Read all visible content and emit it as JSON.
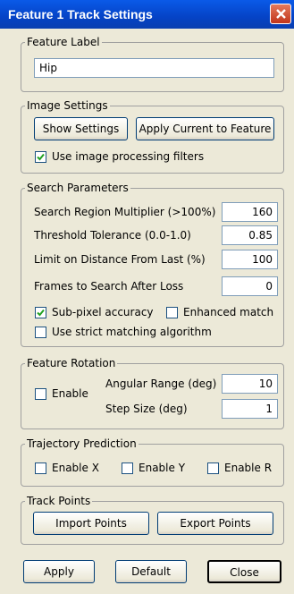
{
  "window": {
    "title": "Feature 1 Track Settings"
  },
  "feature_label": {
    "legend": "Feature Label",
    "value": "Hip"
  },
  "image_settings": {
    "legend": "Image Settings",
    "show_settings": "Show Settings",
    "apply_current": "Apply Current to Feature",
    "use_filters": {
      "label": "Use image processing filters",
      "checked": true
    }
  },
  "search_parameters": {
    "legend": "Search Parameters",
    "fields": [
      {
        "label": "Search Region Multiplier (>100%)",
        "value": "160"
      },
      {
        "label": "Threshold Tolerance (0.0-1.0)",
        "value": "0.85"
      },
      {
        "label": "Limit on Distance From Last (%)",
        "value": "100"
      },
      {
        "label": "Frames to Search After Loss",
        "value": "0"
      }
    ],
    "subpixel": {
      "label": "Sub-pixel accuracy",
      "checked": true
    },
    "enhanced": {
      "label": "Enhanced match",
      "checked": false
    },
    "strict": {
      "label": "Use strict matching algorithm",
      "checked": false
    }
  },
  "feature_rotation": {
    "legend": "Feature Rotation",
    "enable": {
      "label": "Enable",
      "checked": false
    },
    "angular_range": {
      "label": "Angular Range (deg)",
      "value": "10"
    },
    "step_size": {
      "label": "Step Size (deg)",
      "value": "1"
    }
  },
  "trajectory": {
    "legend": "Trajectory Prediction",
    "enable_x": {
      "label": "Enable X",
      "checked": false
    },
    "enable_y": {
      "label": "Enable Y",
      "checked": false
    },
    "enable_r": {
      "label": "Enable R",
      "checked": false
    }
  },
  "track_points": {
    "legend": "Track Points",
    "import": "Import Points",
    "export": "Export Points"
  },
  "footer": {
    "apply": "Apply",
    "default": "Default",
    "close": "Close"
  }
}
